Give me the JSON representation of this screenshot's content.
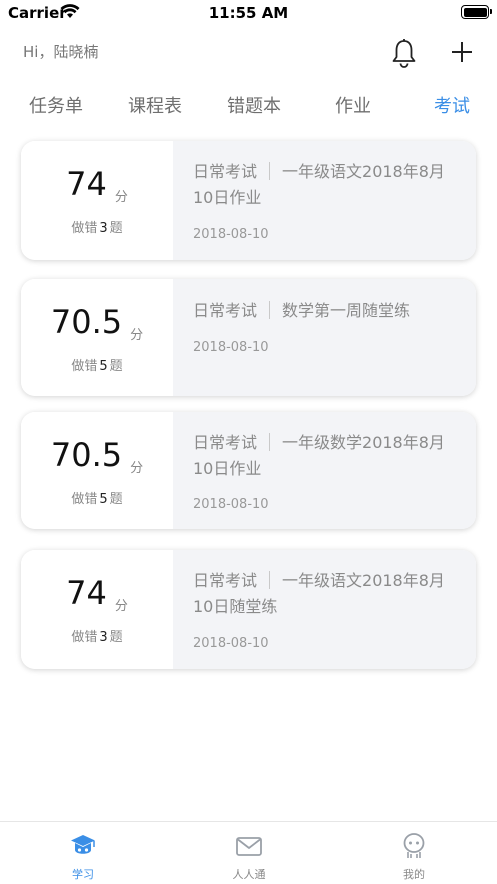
{
  "status_bar": {
    "carrier": "Carrier",
    "time": "11:55 AM"
  },
  "header": {
    "greeting": "Hi，陆晓楠"
  },
  "tabs": [
    {
      "label": "任务单",
      "active": false
    },
    {
      "label": "课程表",
      "active": false
    },
    {
      "label": "错题本",
      "active": false
    },
    {
      "label": "作业",
      "active": false
    },
    {
      "label": "考试",
      "active": true
    }
  ],
  "score_unit": "分",
  "wrong_prefix": "做错",
  "wrong_suffix": "题",
  "exams": [
    {
      "score": "74",
      "wrong": "3",
      "type": "日常考试",
      "title": "一年级语文2018年8月10日作业",
      "date": "2018-08-10"
    },
    {
      "score": "70.5",
      "wrong": "5",
      "type": "日常考试",
      "title": "数学第一周随堂练",
      "date": "2018-08-10"
    },
    {
      "score": "70.5",
      "wrong": "5",
      "type": "日常考试",
      "title": "一年级数学2018年8月10日作业",
      "date": "2018-08-10"
    },
    {
      "score": "74",
      "wrong": "3",
      "type": "日常考试",
      "title": "一年级语文2018年8月10日随堂练",
      "date": "2018-08-10"
    }
  ],
  "tabbar": [
    {
      "label": "学习",
      "icon": "graduation-cap-icon",
      "active": true
    },
    {
      "label": "人人通",
      "icon": "mail-icon",
      "active": false
    },
    {
      "label": "我的",
      "icon": "profile-icon",
      "active": false
    }
  ],
  "colors": {
    "accent": "#3a8ee6",
    "card_right_bg": "#f3f4f7"
  }
}
